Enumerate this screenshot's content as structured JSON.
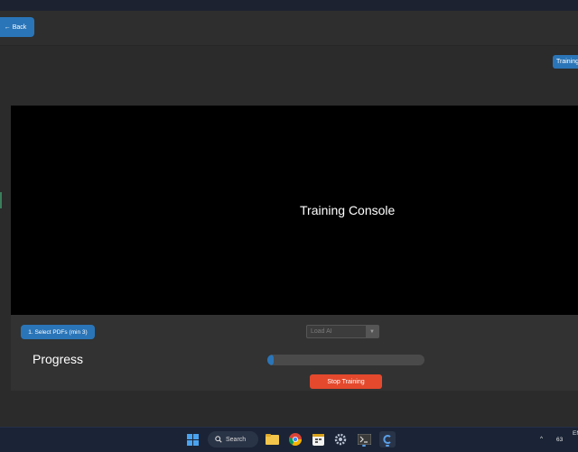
{
  "topbar": {
    "back_label": "Back",
    "back_icon": "arrow-left-icon"
  },
  "main": {
    "training_tab_label": "Training"
  },
  "console": {
    "title": "Training Console"
  },
  "controls": {
    "select_pdfs_label": "1. Select PDFs (min 3)",
    "model_select_placeholder": "Load AI",
    "progress_label": "Progress",
    "progress_value": 0.04,
    "stop_label": "Stop Training"
  },
  "taskbar": {
    "search_label": "Search",
    "apps": [
      "windows-start-icon",
      "file-explorer-icon",
      "chrome-icon",
      "calendar-app-icon",
      "settings-gear-icon",
      "terminal-icon",
      "active-app-icon"
    ],
    "tray_chevron": "^",
    "tray_text": "63",
    "tray_lang": "EN"
  },
  "colors": {
    "accent": "#2a75b8",
    "stop": "#e4492d",
    "console_bg": "#000000",
    "panel_bg": "#2b2b2b"
  }
}
